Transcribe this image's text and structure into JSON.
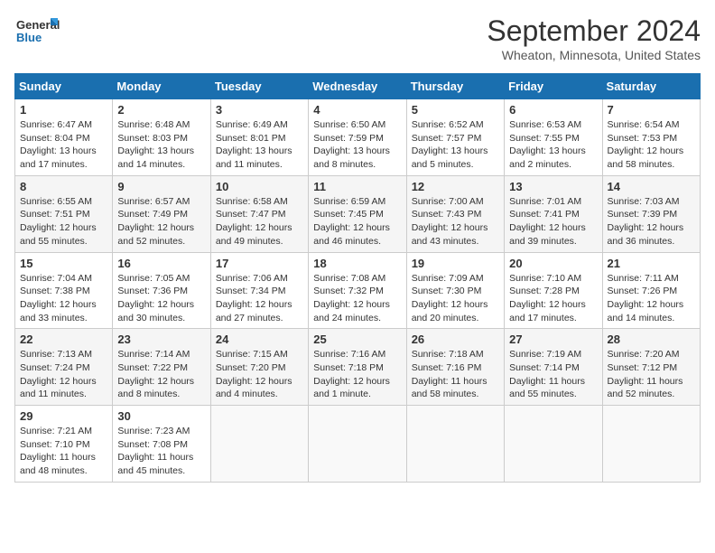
{
  "header": {
    "logo_line1": "General",
    "logo_line2": "Blue",
    "title": "September 2024",
    "location": "Wheaton, Minnesota, United States"
  },
  "days_of_week": [
    "Sunday",
    "Monday",
    "Tuesday",
    "Wednesday",
    "Thursday",
    "Friday",
    "Saturday"
  ],
  "weeks": [
    [
      {
        "day": "1",
        "info": "Sunrise: 6:47 AM\nSunset: 8:04 PM\nDaylight: 13 hours\nand 17 minutes."
      },
      {
        "day": "2",
        "info": "Sunrise: 6:48 AM\nSunset: 8:03 PM\nDaylight: 13 hours\nand 14 minutes."
      },
      {
        "day": "3",
        "info": "Sunrise: 6:49 AM\nSunset: 8:01 PM\nDaylight: 13 hours\nand 11 minutes."
      },
      {
        "day": "4",
        "info": "Sunrise: 6:50 AM\nSunset: 7:59 PM\nDaylight: 13 hours\nand 8 minutes."
      },
      {
        "day": "5",
        "info": "Sunrise: 6:52 AM\nSunset: 7:57 PM\nDaylight: 13 hours\nand 5 minutes."
      },
      {
        "day": "6",
        "info": "Sunrise: 6:53 AM\nSunset: 7:55 PM\nDaylight: 13 hours\nand 2 minutes."
      },
      {
        "day": "7",
        "info": "Sunrise: 6:54 AM\nSunset: 7:53 PM\nDaylight: 12 hours\nand 58 minutes."
      }
    ],
    [
      {
        "day": "8",
        "info": "Sunrise: 6:55 AM\nSunset: 7:51 PM\nDaylight: 12 hours\nand 55 minutes."
      },
      {
        "day": "9",
        "info": "Sunrise: 6:57 AM\nSunset: 7:49 PM\nDaylight: 12 hours\nand 52 minutes."
      },
      {
        "day": "10",
        "info": "Sunrise: 6:58 AM\nSunset: 7:47 PM\nDaylight: 12 hours\nand 49 minutes."
      },
      {
        "day": "11",
        "info": "Sunrise: 6:59 AM\nSunset: 7:45 PM\nDaylight: 12 hours\nand 46 minutes."
      },
      {
        "day": "12",
        "info": "Sunrise: 7:00 AM\nSunset: 7:43 PM\nDaylight: 12 hours\nand 43 minutes."
      },
      {
        "day": "13",
        "info": "Sunrise: 7:01 AM\nSunset: 7:41 PM\nDaylight: 12 hours\nand 39 minutes."
      },
      {
        "day": "14",
        "info": "Sunrise: 7:03 AM\nSunset: 7:39 PM\nDaylight: 12 hours\nand 36 minutes."
      }
    ],
    [
      {
        "day": "15",
        "info": "Sunrise: 7:04 AM\nSunset: 7:38 PM\nDaylight: 12 hours\nand 33 minutes."
      },
      {
        "day": "16",
        "info": "Sunrise: 7:05 AM\nSunset: 7:36 PM\nDaylight: 12 hours\nand 30 minutes."
      },
      {
        "day": "17",
        "info": "Sunrise: 7:06 AM\nSunset: 7:34 PM\nDaylight: 12 hours\nand 27 minutes."
      },
      {
        "day": "18",
        "info": "Sunrise: 7:08 AM\nSunset: 7:32 PM\nDaylight: 12 hours\nand 24 minutes."
      },
      {
        "day": "19",
        "info": "Sunrise: 7:09 AM\nSunset: 7:30 PM\nDaylight: 12 hours\nand 20 minutes."
      },
      {
        "day": "20",
        "info": "Sunrise: 7:10 AM\nSunset: 7:28 PM\nDaylight: 12 hours\nand 17 minutes."
      },
      {
        "day": "21",
        "info": "Sunrise: 7:11 AM\nSunset: 7:26 PM\nDaylight: 12 hours\nand 14 minutes."
      }
    ],
    [
      {
        "day": "22",
        "info": "Sunrise: 7:13 AM\nSunset: 7:24 PM\nDaylight: 12 hours\nand 11 minutes."
      },
      {
        "day": "23",
        "info": "Sunrise: 7:14 AM\nSunset: 7:22 PM\nDaylight: 12 hours\nand 8 minutes."
      },
      {
        "day": "24",
        "info": "Sunrise: 7:15 AM\nSunset: 7:20 PM\nDaylight: 12 hours\nand 4 minutes."
      },
      {
        "day": "25",
        "info": "Sunrise: 7:16 AM\nSunset: 7:18 PM\nDaylight: 12 hours\nand 1 minute."
      },
      {
        "day": "26",
        "info": "Sunrise: 7:18 AM\nSunset: 7:16 PM\nDaylight: 11 hours\nand 58 minutes."
      },
      {
        "day": "27",
        "info": "Sunrise: 7:19 AM\nSunset: 7:14 PM\nDaylight: 11 hours\nand 55 minutes."
      },
      {
        "day": "28",
        "info": "Sunrise: 7:20 AM\nSunset: 7:12 PM\nDaylight: 11 hours\nand 52 minutes."
      }
    ],
    [
      {
        "day": "29",
        "info": "Sunrise: 7:21 AM\nSunset: 7:10 PM\nDaylight: 11 hours\nand 48 minutes."
      },
      {
        "day": "30",
        "info": "Sunrise: 7:23 AM\nSunset: 7:08 PM\nDaylight: 11 hours\nand 45 minutes."
      },
      {
        "day": "",
        "info": ""
      },
      {
        "day": "",
        "info": ""
      },
      {
        "day": "",
        "info": ""
      },
      {
        "day": "",
        "info": ""
      },
      {
        "day": "",
        "info": ""
      }
    ]
  ]
}
